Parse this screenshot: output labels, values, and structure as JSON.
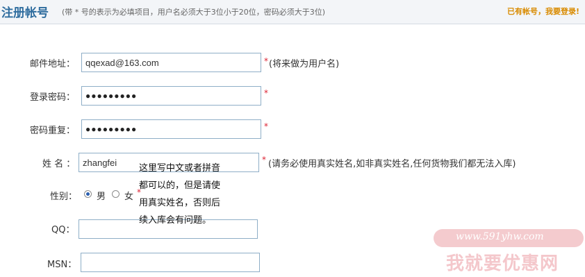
{
  "header": {
    "title": "注册帐号",
    "hint": "(带 * 号的表示为必填项目，用户名必须大于3位小于20位，密码必须大于3位)",
    "login_link": "已有帐号，我要登录!"
  },
  "form": {
    "email": {
      "label": "邮件地址：",
      "value": "qqexad@163.com",
      "required": "*",
      "note": "(将来做为用户名)"
    },
    "password": {
      "label": "登录密码：",
      "value": "●●●●●●●●●",
      "required": "*"
    },
    "password_confirm": {
      "label": "密码重复：",
      "value": "●●●●●●●●●",
      "required": "*"
    },
    "name": {
      "label": "姓 名 ：",
      "value": "zhangfei",
      "required": "*",
      "note": "(请务必使用真实姓名,如非真实姓名,任何货物我们都无法入库)"
    },
    "gender": {
      "label": "性别：",
      "options": [
        "男",
        "女"
      ],
      "selected": "男",
      "required": "*"
    },
    "qq": {
      "label": "QQ：",
      "value": ""
    },
    "msn": {
      "label": "MSN：",
      "value": ""
    }
  },
  "tooltip": {
    "lines": [
      "这里写中文或者拼音",
      "都可以的，但是请使",
      "用真实姓名，否则后",
      "续入库会有问题。"
    ]
  },
  "watermark": {
    "url": "www.591yhw.com",
    "text": "我就要优惠网"
  },
  "colors": {
    "title": "#2e6c9e",
    "link": "#d98b00",
    "required": "#dd2233",
    "input_border": "#8eaec7"
  }
}
